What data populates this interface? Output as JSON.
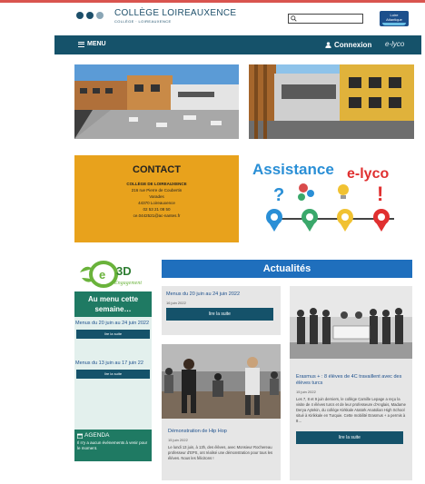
{
  "header": {
    "school_name": "COLLÈGE LOIREAUXENCE",
    "school_sub": "COLLÈGE · LOIREAUXENCE",
    "search_placeholder": "",
    "region_logo_line1": "Loire",
    "region_logo_line2": "Atlantique"
  },
  "nav": {
    "menu_label": "MENU",
    "connexion_label": "Connexion",
    "elyco_label": "e-lyco"
  },
  "contact": {
    "title": "CONTACT",
    "lines": [
      "COLLÈGE DE LOIREAUXENCE",
      "216 rue Pierre de Coubertin",
      "Varades",
      "44370 Loireauxence",
      "02 53 21 08 50",
      "ce.0442521@ac-nantes.fr"
    ]
  },
  "assistance": {
    "word1": "Assistance",
    "word2": "e-lyco"
  },
  "left": {
    "logo_text": "3D",
    "logo_sub": "Engagement",
    "menu_title": "Au menu cette semaine…",
    "entries": [
      {
        "title": "Menus du 20 juin au 24 juin 2022",
        "button": "lire la suite"
      },
      {
        "title": "Menus du 13 juin au 17 juin 22",
        "button": "lire la suite"
      }
    ],
    "agenda_title": "AGENDA",
    "agenda_text": "Il n'y a aucun événements à venir pour le moment."
  },
  "news": {
    "heading": "Actualités",
    "cards": [
      {
        "title": "Menus du 20 juin au 24 juin 2022",
        "date": "16 juin 2022",
        "button": "lire la suite"
      },
      {
        "title": "Démonstration de Hip Hop",
        "date": "15 juin 2022",
        "text": "Le lundi 13 juin, à 13h, des élèves, avec Monsieur Rochereau professeur d'EPS, ont réalisé une démonstration pour tous les élèves. Nous les félicitons !"
      },
      {
        "title": "Erasmus + : 8 élèves de 4C travaillent avec des élèves turcs",
        "date": "15 juin 2022",
        "text": "Les 7, 8 et 9 juin derniers, le collège Camille Lepage a reçu la visite de 4 élèves turcs et de leur professeure d'Anglais, Madame Derya Aytekin, du collège Kirkkale Atatürk Anatolian High School situé à Kirikkale en Turquie. Cette mobilité Erasmus + a permis à 8…",
        "button": "lire la suite"
      }
    ]
  },
  "colors": {
    "brand": "#15526a",
    "news_blue": "#1f6fbd",
    "green": "#1f7a63",
    "contact_orange": "#e8a21c"
  }
}
